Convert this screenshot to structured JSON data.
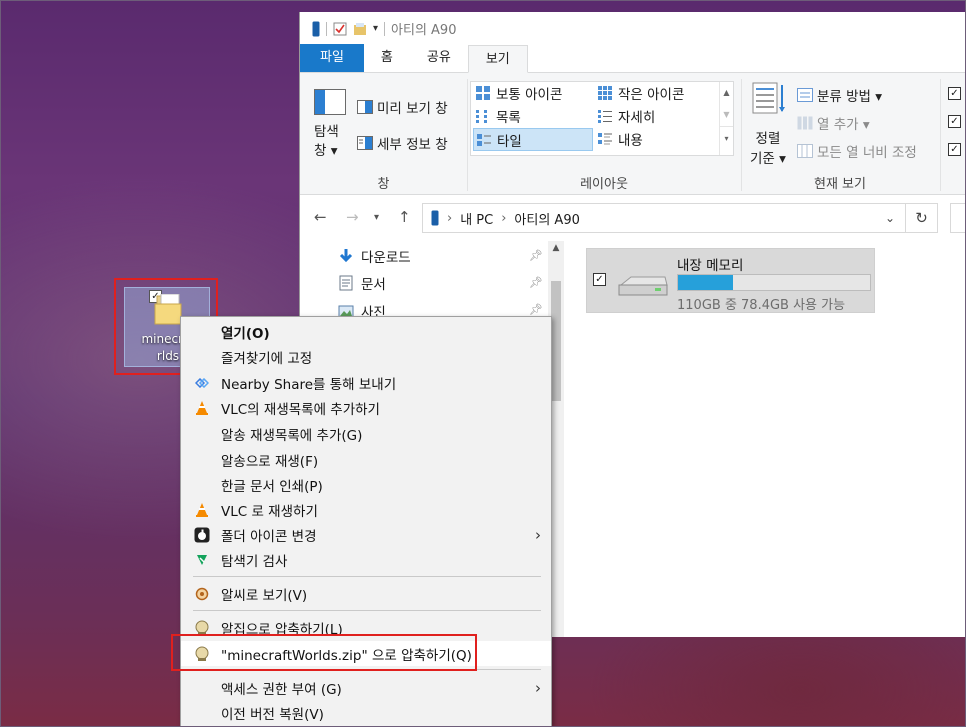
{
  "explorer": {
    "title": "아티의 A90",
    "tabs": [
      {
        "label": "파일"
      },
      {
        "label": "홈"
      },
      {
        "label": "공유"
      },
      {
        "label": "보기"
      }
    ],
    "ribbon": {
      "panes": {
        "nav_pane_label_1": "탐색",
        "nav_pane_label_2": "창 ▾",
        "preview_pane": "미리 보기 창",
        "details_pane": "세부 정보 창",
        "group_label": "창"
      },
      "layout": {
        "items": [
          "보통 아이콘",
          "작은 아이콘",
          "목록",
          "자세히",
          "타일",
          "내용"
        ],
        "selected": "타일",
        "group_label": "레이아웃"
      },
      "current_view": {
        "sort_label_1": "정렬",
        "sort_label_2": "기준 ▾",
        "group_by": "분류 방법 ▾",
        "add_columns": "열 추가 ▾",
        "size_all_columns": "모든 열 너비 조정",
        "group_label": "현재 보기"
      }
    },
    "address": {
      "path": [
        "내 PC",
        "아티의 A90"
      ]
    },
    "nav_pane": {
      "items": [
        {
          "label": "다운로드",
          "icon": "download-arrow-icon"
        },
        {
          "label": "문서",
          "icon": "document-icon"
        },
        {
          "label": "사진",
          "icon": "pictures-icon"
        }
      ]
    },
    "drive": {
      "name": "내장 메모리",
      "free_text": "110GB 중 78.4GB 사용 가능",
      "used_fraction": 0.287
    }
  },
  "desktop": {
    "icon_label_line1": "minecraf",
    "icon_label_line2": "rlds"
  },
  "context_menu": {
    "items": [
      {
        "label": "열기(O)",
        "bold": true
      },
      {
        "label": "즐겨찾기에 고정"
      },
      {
        "label": "Nearby Share를 통해 보내기",
        "icon": "nearby-share-icon"
      },
      {
        "label": "VLC의 재생목록에 추가하기",
        "icon": "vlc-cone-icon"
      },
      {
        "label": "알송 재생목록에 추가(G)"
      },
      {
        "label": "알송으로 재생(F)"
      },
      {
        "label": "한글 문서 인쇄(P)"
      },
      {
        "label": "VLC 로 재생하기",
        "icon": "vlc-cone-icon"
      },
      {
        "label": "폴더 아이콘 변경",
        "icon": "apple-icon",
        "submenu": true
      },
      {
        "label": "탐색기 검사",
        "icon": "explorer-check-icon"
      },
      {
        "label": "알씨로 보기(V)",
        "icon": "alsee-icon"
      },
      {
        "label": "알집으로 압축하기(L)",
        "icon": "alzip-icon"
      },
      {
        "label": "\"minecraftWorlds.zip\" 으로 압축하기(Q)",
        "icon": "alzip-icon"
      },
      {
        "label": "액세스 권한 부여 (G)",
        "submenu": true
      },
      {
        "label": "이전 버전 복원(V)"
      }
    ]
  },
  "colors": {
    "accent": "#1979ca",
    "selection_fill": "#cce4f7",
    "drive_bar": "#26a0da",
    "highlight_box": "#e0201e"
  }
}
